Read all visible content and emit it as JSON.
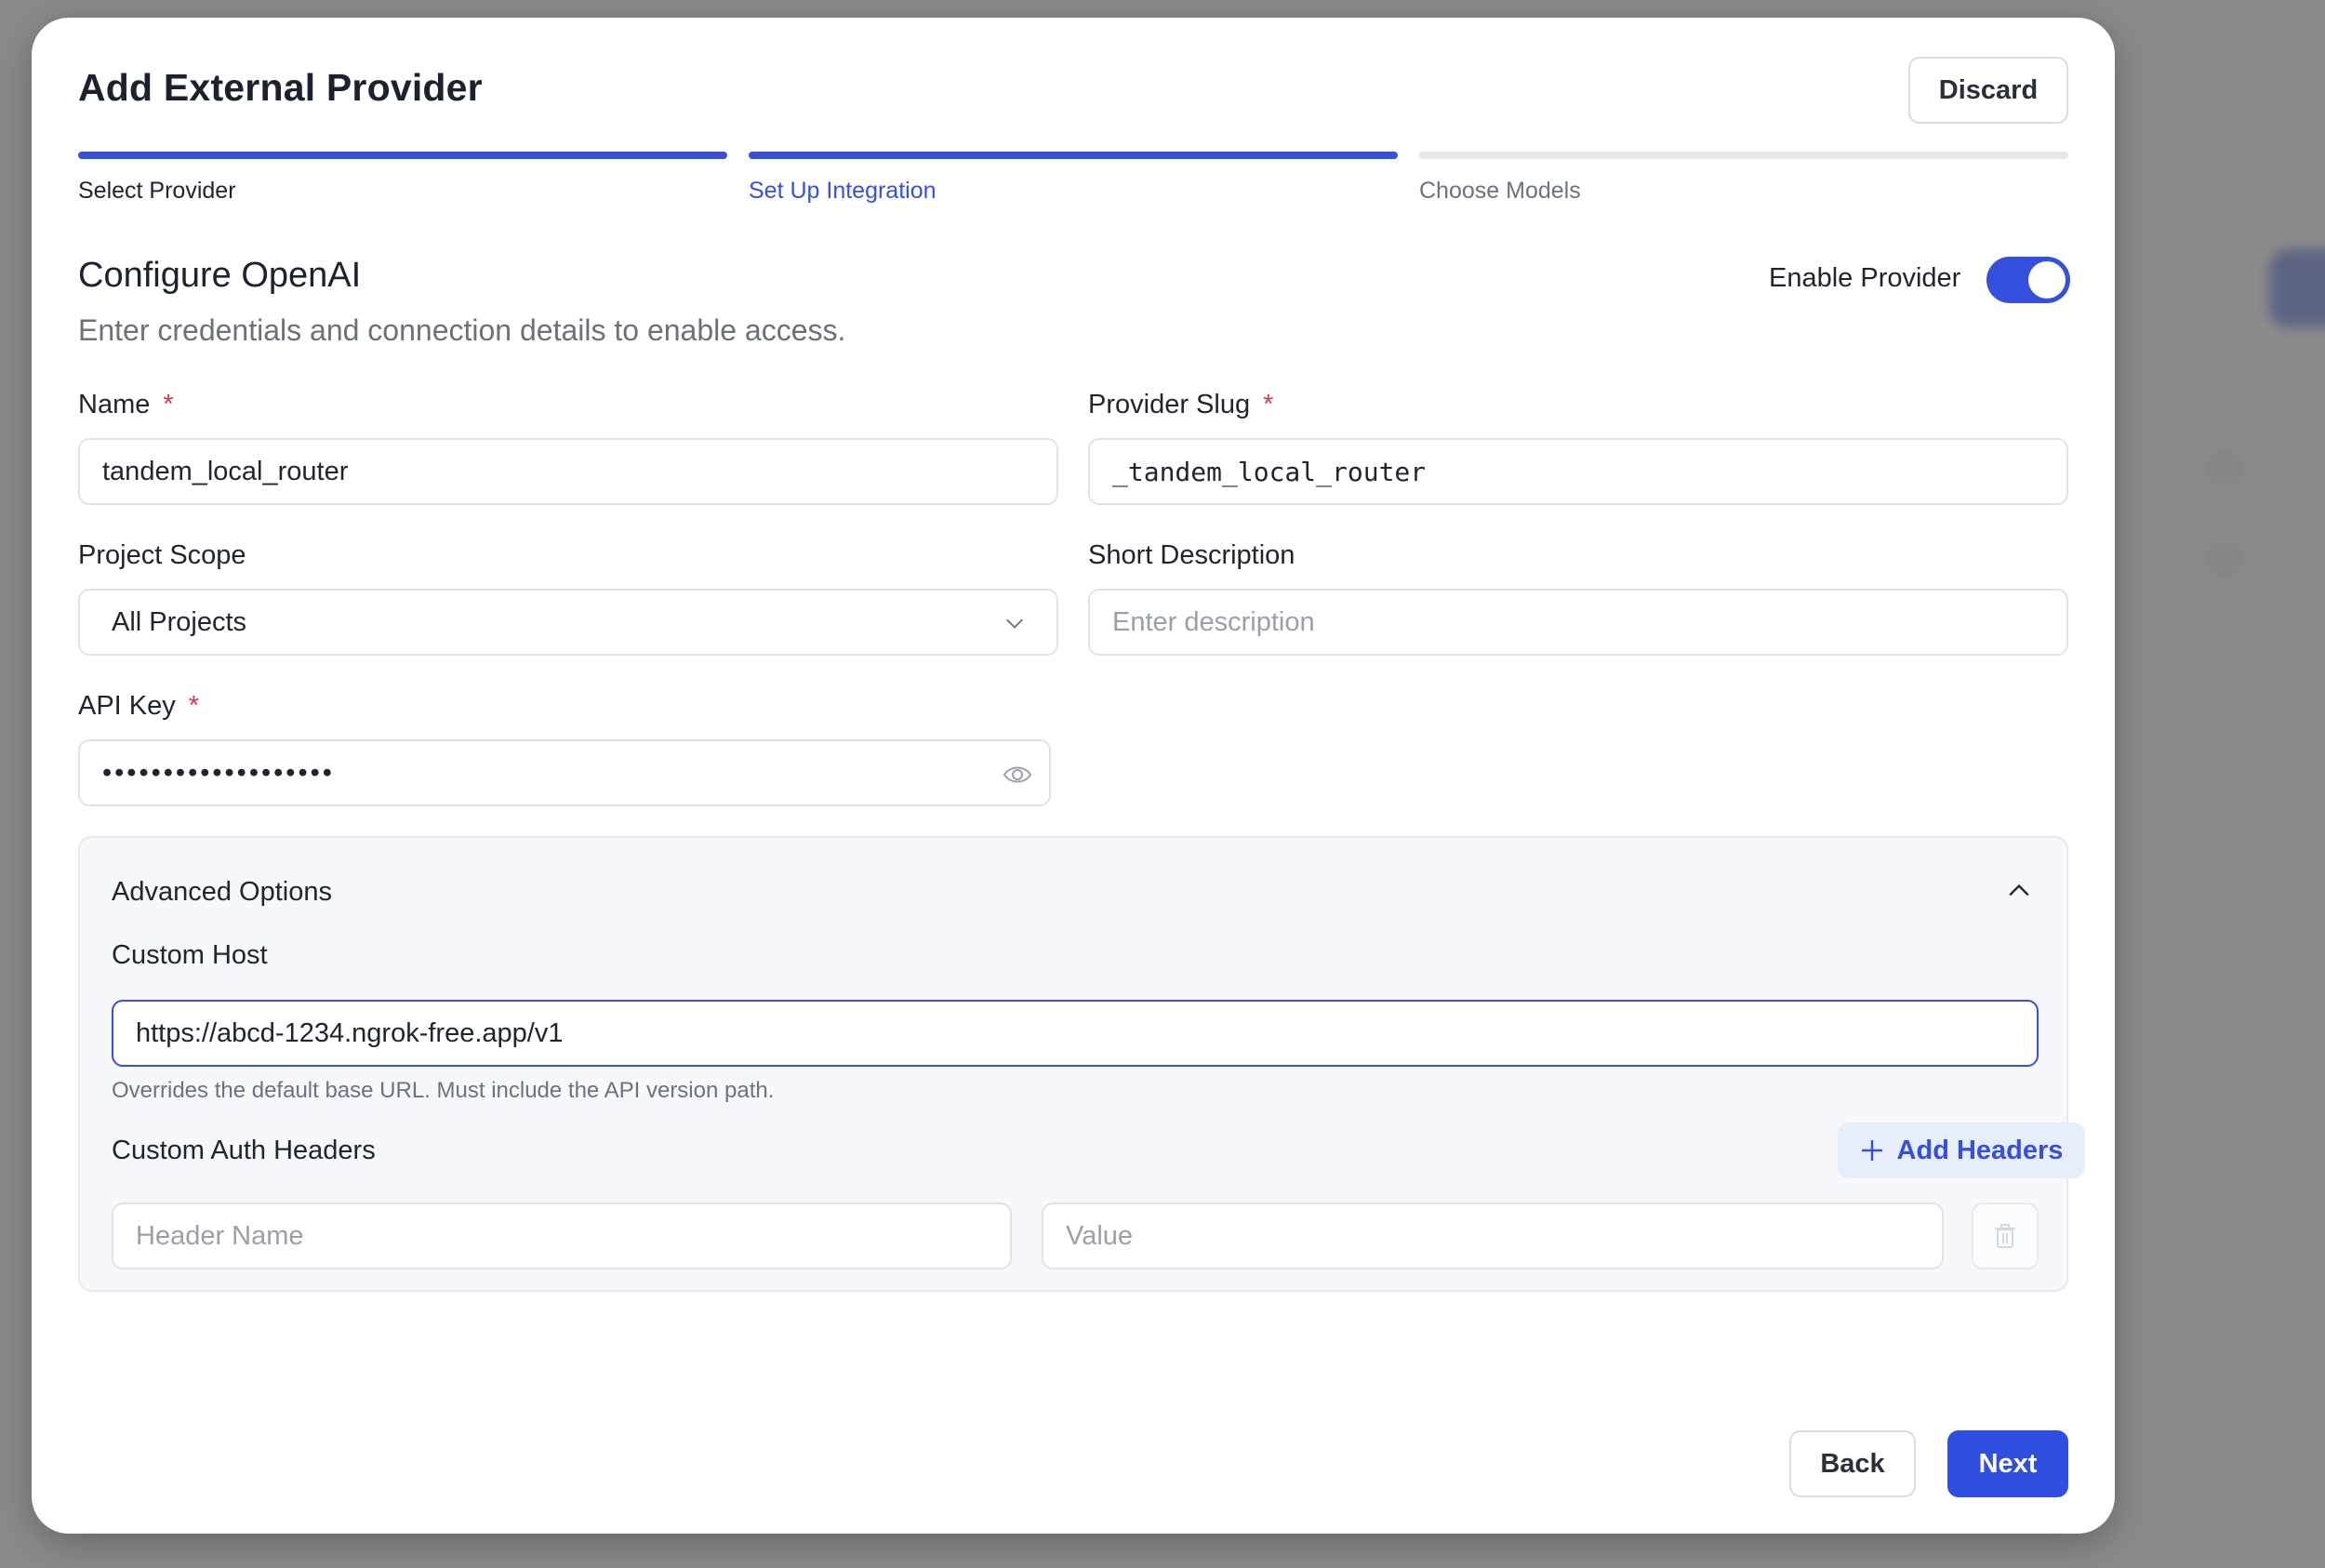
{
  "dialog": {
    "title": "Add External Provider",
    "discard_label": "Discard"
  },
  "stepper": {
    "steps": [
      {
        "label": "Select Provider",
        "state": "done"
      },
      {
        "label": "Set Up Integration",
        "state": "active"
      },
      {
        "label": "Choose Models",
        "state": "pending"
      }
    ]
  },
  "section": {
    "title": "Configure OpenAI",
    "subtitle": "Enter credentials and connection details to enable access.",
    "enable_label": "Enable Provider",
    "enabled": true
  },
  "form": {
    "name": {
      "label": "Name",
      "required": "*",
      "value": "tandem_local_router"
    },
    "slug": {
      "label": "Provider Slug",
      "required": "*",
      "value": "_tandem_local_router"
    },
    "scope": {
      "label": "Project Scope",
      "value": "All Projects"
    },
    "description": {
      "label": "Short Description",
      "placeholder": "Enter description"
    },
    "api_key": {
      "label": "API Key",
      "required": "*",
      "masked_value": "•••••••••••••••••••"
    }
  },
  "advanced": {
    "title": "Advanced Options",
    "custom_host": {
      "label": "Custom Host",
      "value": "https://abcd-1234.ngrok-free.app/v1",
      "help": "Overrides the default base URL. Must include the API version path."
    },
    "auth_headers": {
      "label": "Custom Auth Headers",
      "add_label": "Add Headers",
      "name_placeholder": "Header Name",
      "value_placeholder": "Value"
    }
  },
  "footer": {
    "back_label": "Back",
    "next_label": "Next"
  },
  "colors": {
    "accent": "#3650de",
    "required": "#e0334c",
    "overlay": "#8a8a8a"
  },
  "icons": [
    "chevron-down-icon",
    "eye-icon",
    "chevron-up-icon",
    "plus-icon",
    "trash-icon"
  ]
}
